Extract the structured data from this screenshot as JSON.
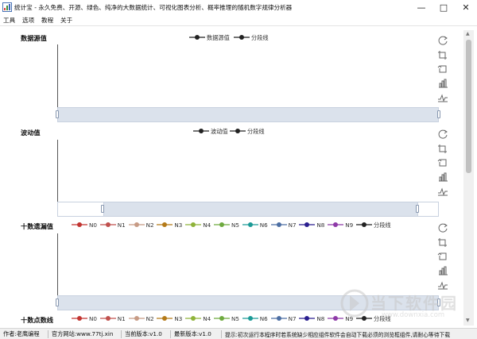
{
  "window": {
    "title": "统计宝 - 永久免费、开源、绿色、纯净的大数据统计、可视化图表分析、概率推理的随机数字规律分析器",
    "minimize": "—",
    "maximize": "□",
    "close": "✕"
  },
  "menu": [
    "工具",
    "选项",
    "教程",
    "关于"
  ],
  "panels": {
    "source": {
      "title": "数据源值",
      "legend": [
        "数据源值",
        "分段线"
      ]
    },
    "wave": {
      "title": "波动值",
      "legend": [
        "波动值",
        "分段线"
      ]
    },
    "missing": {
      "title": "十数遗漏值",
      "legend": [
        "N0",
        "N1",
        "N2",
        "N3",
        "N4",
        "N5",
        "N6",
        "N7",
        "N8",
        "N9",
        "分段线"
      ]
    },
    "points": {
      "title": "十数点数线",
      "legend": [
        "N0",
        "N1",
        "N2",
        "N3",
        "N4",
        "N5",
        "N6",
        "N7",
        "N8",
        "N9",
        "分段线"
      ]
    }
  },
  "series_colors": {
    "single": "#222222",
    "N0": "#c23531",
    "N1": "#c0504d",
    "N2": "#c79b85",
    "N3": "#b47a18",
    "N4": "#8fb33a",
    "N5": "#6eaa3f",
    "N6": "#1b9a96",
    "N7": "#4d6fa3",
    "N8": "#2a1f8f",
    "N9": "#8e3aa8",
    "segment": "#222222"
  },
  "toolbox_icons": [
    "restore-icon",
    "zoom-icon",
    "zoom-back-icon",
    "bar-chart-icon",
    "line-chart-icon"
  ],
  "chart_data": [
    {
      "type": "line",
      "title": "数据源值",
      "series": [
        {
          "name": "数据源值",
          "values": []
        },
        {
          "name": "分段线",
          "values": []
        }
      ],
      "zoom": [
        0,
        100
      ]
    },
    {
      "type": "line",
      "title": "波动值",
      "series": [
        {
          "name": "波动值",
          "values": []
        },
        {
          "name": "分段线",
          "values": []
        }
      ],
      "zoom": [
        12,
        100
      ]
    },
    {
      "type": "line",
      "title": "十数遗漏值",
      "series": [
        {
          "name": "N0",
          "values": []
        },
        {
          "name": "N1",
          "values": []
        },
        {
          "name": "N2",
          "values": []
        },
        {
          "name": "N3",
          "values": []
        },
        {
          "name": "N4",
          "values": []
        },
        {
          "name": "N5",
          "values": []
        },
        {
          "name": "N6",
          "values": []
        },
        {
          "name": "N7",
          "values": []
        },
        {
          "name": "N8",
          "values": []
        },
        {
          "name": "N9",
          "values": []
        },
        {
          "name": "分段线",
          "values": []
        }
      ],
      "zoom": [
        0,
        100
      ]
    },
    {
      "type": "line",
      "title": "十数点数线",
      "series": [
        {
          "name": "N0",
          "values": []
        },
        {
          "name": "N1",
          "values": []
        },
        {
          "name": "N2",
          "values": []
        },
        {
          "name": "N3",
          "values": []
        },
        {
          "name": "N4",
          "values": []
        },
        {
          "name": "N5",
          "values": []
        },
        {
          "name": "N6",
          "values": []
        },
        {
          "name": "N7",
          "values": []
        },
        {
          "name": "N8",
          "values": []
        },
        {
          "name": "N9",
          "values": []
        },
        {
          "name": "分段线",
          "values": []
        }
      ],
      "zoom": [
        0,
        100
      ]
    }
  ],
  "status": {
    "author": "作者:老鹰编程",
    "website": "官方网站:www.77tj.xin",
    "current_version": "当前版本:v1.0",
    "latest_version": "最新版本:v1.0",
    "tip": "提示:初次运行本程序时若系统缺少相应组件软件会自动下载必须的浏览框组件,请耐心等待下载"
  },
  "watermark": {
    "name": "当下软件园",
    "url": "www.downxia.com"
  }
}
